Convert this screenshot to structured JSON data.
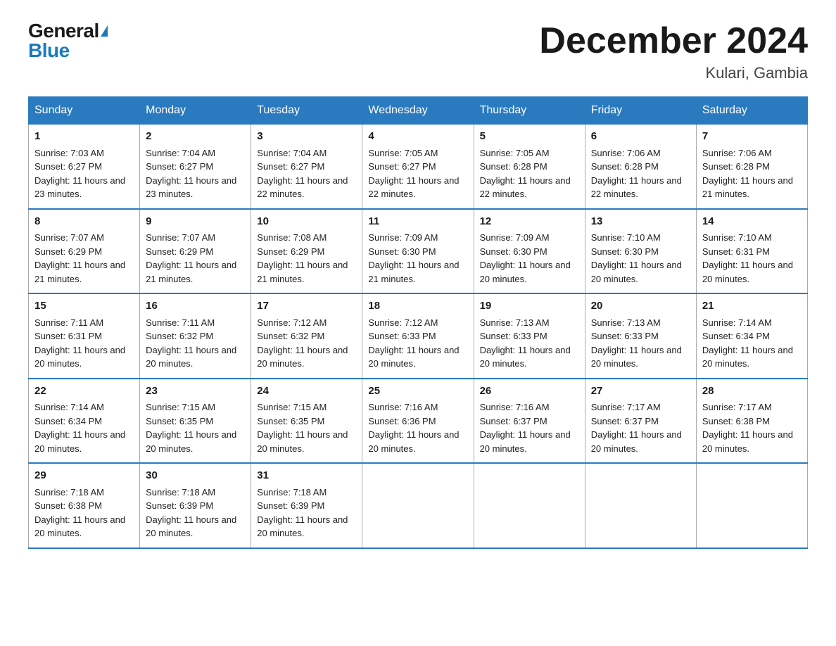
{
  "logo": {
    "general": "General",
    "blue": "Blue"
  },
  "title": "December 2024",
  "location": "Kulari, Gambia",
  "days_of_week": [
    "Sunday",
    "Monday",
    "Tuesday",
    "Wednesday",
    "Thursday",
    "Friday",
    "Saturday"
  ],
  "weeks": [
    [
      {
        "day": "1",
        "sunrise": "7:03 AM",
        "sunset": "6:27 PM",
        "daylight": "11 hours and 23 minutes."
      },
      {
        "day": "2",
        "sunrise": "7:04 AM",
        "sunset": "6:27 PM",
        "daylight": "11 hours and 23 minutes."
      },
      {
        "day": "3",
        "sunrise": "7:04 AM",
        "sunset": "6:27 PM",
        "daylight": "11 hours and 22 minutes."
      },
      {
        "day": "4",
        "sunrise": "7:05 AM",
        "sunset": "6:27 PM",
        "daylight": "11 hours and 22 minutes."
      },
      {
        "day": "5",
        "sunrise": "7:05 AM",
        "sunset": "6:28 PM",
        "daylight": "11 hours and 22 minutes."
      },
      {
        "day": "6",
        "sunrise": "7:06 AM",
        "sunset": "6:28 PM",
        "daylight": "11 hours and 22 minutes."
      },
      {
        "day": "7",
        "sunrise": "7:06 AM",
        "sunset": "6:28 PM",
        "daylight": "11 hours and 21 minutes."
      }
    ],
    [
      {
        "day": "8",
        "sunrise": "7:07 AM",
        "sunset": "6:29 PM",
        "daylight": "11 hours and 21 minutes."
      },
      {
        "day": "9",
        "sunrise": "7:07 AM",
        "sunset": "6:29 PM",
        "daylight": "11 hours and 21 minutes."
      },
      {
        "day": "10",
        "sunrise": "7:08 AM",
        "sunset": "6:29 PM",
        "daylight": "11 hours and 21 minutes."
      },
      {
        "day": "11",
        "sunrise": "7:09 AM",
        "sunset": "6:30 PM",
        "daylight": "11 hours and 21 minutes."
      },
      {
        "day": "12",
        "sunrise": "7:09 AM",
        "sunset": "6:30 PM",
        "daylight": "11 hours and 20 minutes."
      },
      {
        "day": "13",
        "sunrise": "7:10 AM",
        "sunset": "6:30 PM",
        "daylight": "11 hours and 20 minutes."
      },
      {
        "day": "14",
        "sunrise": "7:10 AM",
        "sunset": "6:31 PM",
        "daylight": "11 hours and 20 minutes."
      }
    ],
    [
      {
        "day": "15",
        "sunrise": "7:11 AM",
        "sunset": "6:31 PM",
        "daylight": "11 hours and 20 minutes."
      },
      {
        "day": "16",
        "sunrise": "7:11 AM",
        "sunset": "6:32 PM",
        "daylight": "11 hours and 20 minutes."
      },
      {
        "day": "17",
        "sunrise": "7:12 AM",
        "sunset": "6:32 PM",
        "daylight": "11 hours and 20 minutes."
      },
      {
        "day": "18",
        "sunrise": "7:12 AM",
        "sunset": "6:33 PM",
        "daylight": "11 hours and 20 minutes."
      },
      {
        "day": "19",
        "sunrise": "7:13 AM",
        "sunset": "6:33 PM",
        "daylight": "11 hours and 20 minutes."
      },
      {
        "day": "20",
        "sunrise": "7:13 AM",
        "sunset": "6:33 PM",
        "daylight": "11 hours and 20 minutes."
      },
      {
        "day": "21",
        "sunrise": "7:14 AM",
        "sunset": "6:34 PM",
        "daylight": "11 hours and 20 minutes."
      }
    ],
    [
      {
        "day": "22",
        "sunrise": "7:14 AM",
        "sunset": "6:34 PM",
        "daylight": "11 hours and 20 minutes."
      },
      {
        "day": "23",
        "sunrise": "7:15 AM",
        "sunset": "6:35 PM",
        "daylight": "11 hours and 20 minutes."
      },
      {
        "day": "24",
        "sunrise": "7:15 AM",
        "sunset": "6:35 PM",
        "daylight": "11 hours and 20 minutes."
      },
      {
        "day": "25",
        "sunrise": "7:16 AM",
        "sunset": "6:36 PM",
        "daylight": "11 hours and 20 minutes."
      },
      {
        "day": "26",
        "sunrise": "7:16 AM",
        "sunset": "6:37 PM",
        "daylight": "11 hours and 20 minutes."
      },
      {
        "day": "27",
        "sunrise": "7:17 AM",
        "sunset": "6:37 PM",
        "daylight": "11 hours and 20 minutes."
      },
      {
        "day": "28",
        "sunrise": "7:17 AM",
        "sunset": "6:38 PM",
        "daylight": "11 hours and 20 minutes."
      }
    ],
    [
      {
        "day": "29",
        "sunrise": "7:18 AM",
        "sunset": "6:38 PM",
        "daylight": "11 hours and 20 minutes."
      },
      {
        "day": "30",
        "sunrise": "7:18 AM",
        "sunset": "6:39 PM",
        "daylight": "11 hours and 20 minutes."
      },
      {
        "day": "31",
        "sunrise": "7:18 AM",
        "sunset": "6:39 PM",
        "daylight": "11 hours and 20 minutes."
      },
      null,
      null,
      null,
      null
    ]
  ]
}
